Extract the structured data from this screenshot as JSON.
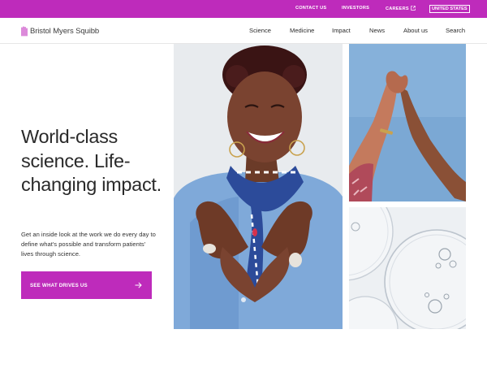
{
  "utility_bar": {
    "contact": "CONTACT US",
    "investors": "INVESTORS",
    "careers": "CAREERS",
    "country": "UNITED STATES",
    "color": "#be2bbb"
  },
  "header": {
    "brand": "Bristol Myers Squibb",
    "nav": {
      "science": "Science",
      "medicine": "Medicine",
      "impact": "Impact",
      "news": "News",
      "about": "About us",
      "search": "Search"
    }
  },
  "hero": {
    "title": "World-class science. Life-changing impact.",
    "body": "Get an inside look at the work we do every day to define what's possible and transform patients' lives through science.",
    "cta_label": "SEE WHAT DRIVES US",
    "cta_icon": "arrow-right-icon"
  },
  "images": {
    "main": "smiling-woman-heart-hands-photo",
    "top_right": "raised-joined-hands-photo",
    "bottom_right": "petri-dish-photo"
  }
}
